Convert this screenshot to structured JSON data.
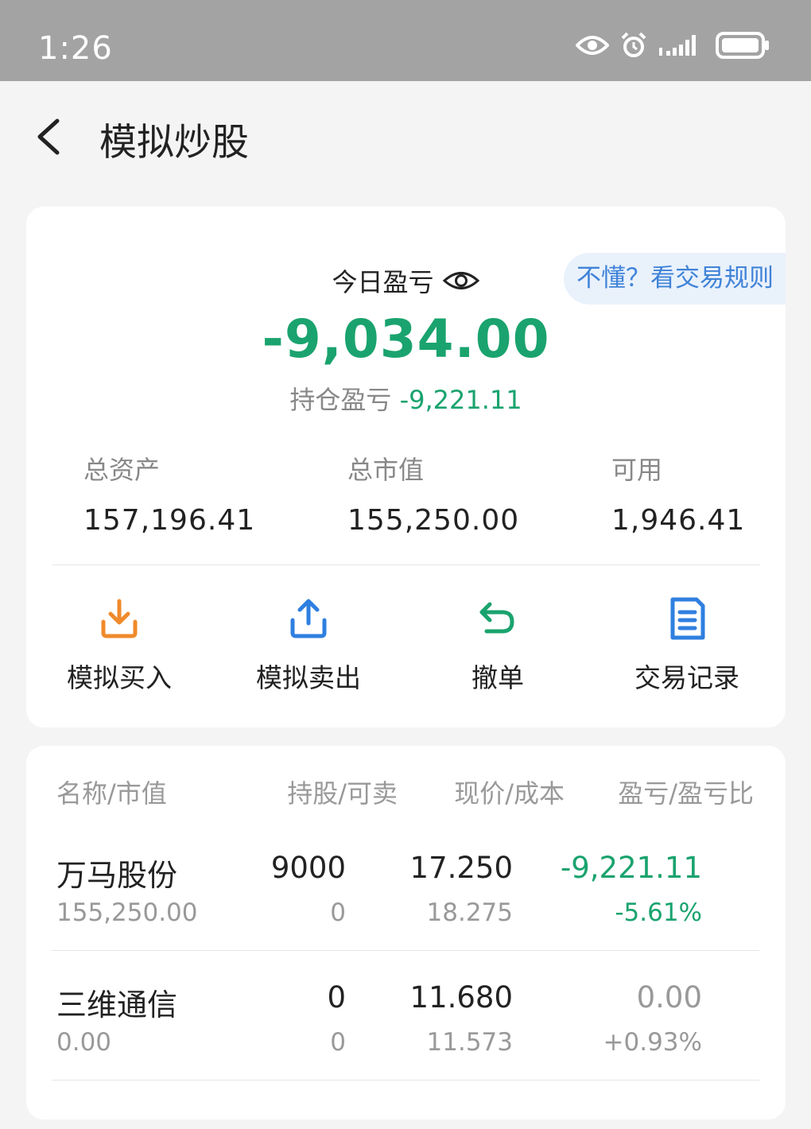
{
  "status_bar": {
    "time": "1:26"
  },
  "header": {
    "title": "模拟炒股"
  },
  "summary": {
    "today_label": "今日盈亏",
    "today_value": "-9,034.00",
    "rules_link": "不懂？看交易规则",
    "position_label": "持仓盈亏",
    "position_value": "-9,221.11",
    "total_assets_label": "总资产",
    "total_assets_value": "157,196.41",
    "market_value_label": "总市值",
    "market_value_value": "155,250.00",
    "available_label": "可用",
    "available_value": "1,946.41"
  },
  "actions": [
    {
      "label": "模拟买入",
      "icon": "download-tray-icon",
      "color": "#f08a2b"
    },
    {
      "label": "模拟卖出",
      "icon": "upload-tray-icon",
      "color": "#2f7fe0"
    },
    {
      "label": "撤单",
      "icon": "undo-arrow-icon",
      "color": "#1aa36e"
    },
    {
      "label": "交易记录",
      "icon": "document-list-icon",
      "color": "#2f7fe0"
    }
  ],
  "holdings": {
    "headers": {
      "name": "名称/市值",
      "hold": "持股/可卖",
      "price": "现价/成本",
      "pl": "盈亏/盈亏比"
    },
    "rows": [
      {
        "name": "万马股份",
        "market_value": "155,250.00",
        "shares": "9000",
        "sellable": "0",
        "price": "17.250",
        "cost": "18.275",
        "pl": "-9,221.11",
        "pl_ratio": "-5.61%"
      },
      {
        "name": "三维通信",
        "market_value": "0.00",
        "shares": "0",
        "sellable": "0",
        "price": "11.680",
        "cost": "11.573",
        "pl": "0.00",
        "pl_ratio": "+0.93%"
      }
    ]
  },
  "colors": {
    "loss_green": "#1aa36e",
    "link_blue": "#3f83d8",
    "status_bar": "#a3a3a3"
  }
}
